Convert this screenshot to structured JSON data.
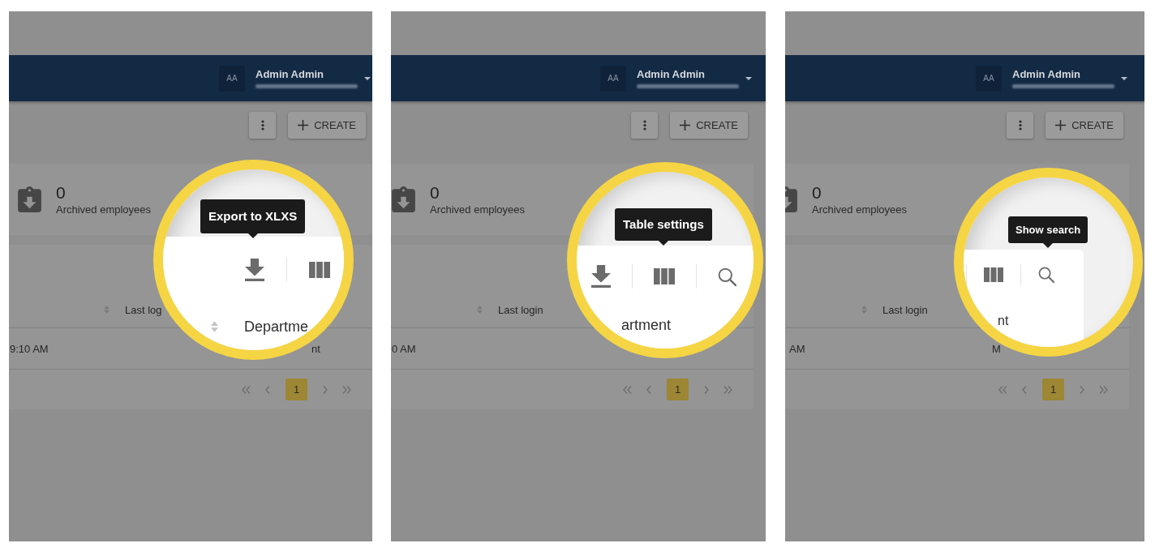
{
  "panels": [
    {
      "header": {
        "avatar": "AA",
        "user_name": "Admin Admin"
      },
      "toolbar": {
        "create_button": "CREATE"
      },
      "stat_card": {
        "value": "0",
        "label": "Archived employees"
      },
      "table": {
        "column_header": "Last log",
        "row": [
          "9:10 AM",
          "nt"
        ],
        "pagination": [
          {
            "kind": "first"
          },
          {
            "kind": "prev"
          },
          {
            "kind": "page",
            "label": "1",
            "selected": true
          },
          {
            "kind": "next"
          },
          {
            "kind": "last"
          }
        ]
      },
      "magnifier": {
        "tooltip": "Export to XLXS",
        "tools": [
          {
            "kind": "download"
          },
          {
            "kind": "divider"
          },
          {
            "kind": "columns"
          }
        ],
        "column_header": "Departme",
        "sortable": true
      }
    },
    {
      "header": {
        "avatar": "AA",
        "user_name": "Admin Admin"
      },
      "toolbar": {
        "create_button": "CREATE"
      },
      "stat_card": {
        "value": "0",
        "label": "Archived employees"
      },
      "table": {
        "column_header": "Last login",
        "row": [
          "0 AM"
        ],
        "pagination": [
          {
            "kind": "first"
          },
          {
            "kind": "prev"
          },
          {
            "kind": "page",
            "label": "1",
            "selected": true
          },
          {
            "kind": "next"
          },
          {
            "kind": "last"
          }
        ]
      },
      "magnifier": {
        "tooltip": "Table settings",
        "tools": [
          {
            "kind": "download"
          },
          {
            "kind": "divider"
          },
          {
            "kind": "columns"
          },
          {
            "kind": "divider"
          },
          {
            "kind": "search"
          }
        ],
        "column_header": "artment",
        "sortable": false
      }
    },
    {
      "header": {
        "avatar": "AA",
        "user_name": "Admin Admin"
      },
      "toolbar": {
        "create_button": "CREATE"
      },
      "stat_card": {
        "value": "0",
        "label": "Archived employees"
      },
      "table": {
        "column_header": "Last login",
        "row": [
          "AM",
          "M"
        ],
        "pagination": [
          {
            "kind": "first"
          },
          {
            "kind": "prev"
          },
          {
            "kind": "page",
            "label": "1",
            "selected": true
          },
          {
            "kind": "next"
          },
          {
            "kind": "last"
          }
        ]
      },
      "magnifier": {
        "tooltip": "Show search",
        "tools": [
          {
            "kind": "divider"
          },
          {
            "kind": "columns"
          },
          {
            "kind": "divider"
          },
          {
            "kind": "search"
          }
        ],
        "column_header": "nt",
        "sortable": false
      }
    }
  ]
}
